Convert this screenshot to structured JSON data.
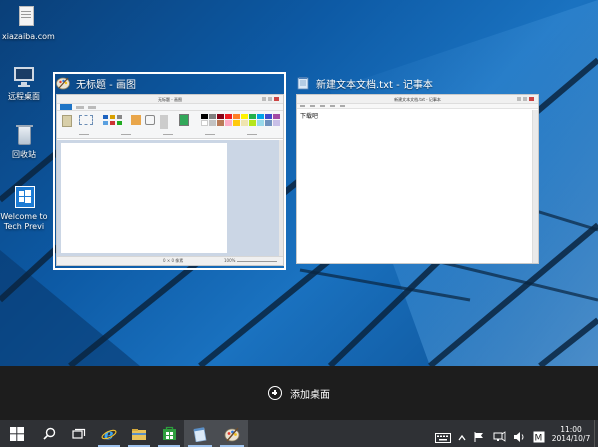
{
  "desktop": {
    "icons": [
      {
        "label": "xiazaiba.com"
      },
      {
        "label": "远程桌面"
      },
      {
        "label": "回收站"
      },
      {
        "label": "Welcome to Tech Previ"
      }
    ]
  },
  "task_view": {
    "windows": [
      {
        "title": "无标题 - 画图",
        "inner_title": "无标题 - 画图",
        "status": "0 × 0 像素",
        "zoom": "100%"
      },
      {
        "title": "新建文本文档.txt - 记事本",
        "inner_title": "新建文本文档.txt - 记事本",
        "text": "下载吧"
      }
    ],
    "add_desktop_label": "添加桌面"
  },
  "taskbar": {
    "buttons": [
      {
        "name": "start-button"
      },
      {
        "name": "search-button"
      },
      {
        "name": "task-view-button"
      },
      {
        "name": "internet-explorer-button"
      },
      {
        "name": "file-explorer-button"
      },
      {
        "name": "store-button"
      },
      {
        "name": "notepad-button"
      },
      {
        "name": "paint-button"
      }
    ],
    "clock": {
      "time": "11:00",
      "date": "2014/10/7"
    }
  },
  "colors": {
    "taskbar": "#2f3135",
    "taskview_bar": "#1d1d1d",
    "accent": "#0b5fa6"
  }
}
